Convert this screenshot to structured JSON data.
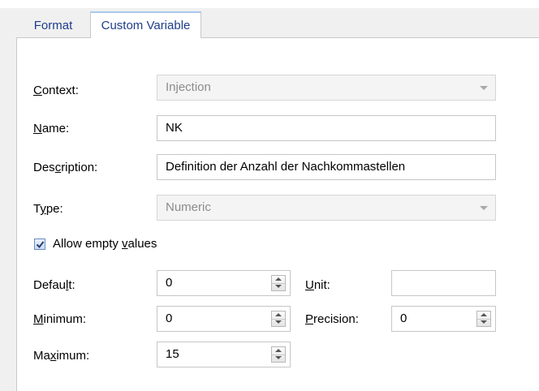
{
  "tabs": [
    {
      "label": "Format",
      "active": false
    },
    {
      "label": "Custom Variable",
      "active": true
    }
  ],
  "form": {
    "context": {
      "label_pre": "",
      "label_key": "C",
      "label_post": "ontext:",
      "value": "Injection"
    },
    "name": {
      "label_pre": "",
      "label_key": "N",
      "label_post": "ame:",
      "value": "NK"
    },
    "description": {
      "label_pre": "Des",
      "label_key": "c",
      "label_post": "ription:",
      "value": "Definition der Anzahl der Nachkommastellen"
    },
    "type": {
      "label_pre": "T",
      "label_key": "y",
      "label_post": "pe:",
      "value": "Numeric"
    },
    "allow_empty": {
      "label_pre": "Allow empty ",
      "label_key": "v",
      "label_post": "alues",
      "checked": true
    },
    "default": {
      "label_pre": "Defau",
      "label_key": "l",
      "label_post": "t:",
      "value": "0"
    },
    "minimum": {
      "label_pre": "",
      "label_key": "M",
      "label_post": "inimum:",
      "value": "0"
    },
    "maximum": {
      "label_pre": "Ma",
      "label_key": "x",
      "label_post": "imum:",
      "value": "15"
    },
    "unit": {
      "label_pre": "",
      "label_key": "U",
      "label_post": "nit:",
      "value": ""
    },
    "precision": {
      "label_pre": "",
      "label_key": "P",
      "label_post": "recision:",
      "value": "0"
    }
  },
  "colors": {
    "tab_text": "#1e3d8a",
    "tab_active_top": "#a9c8ee",
    "disabled_text": "#8c8c8c"
  }
}
